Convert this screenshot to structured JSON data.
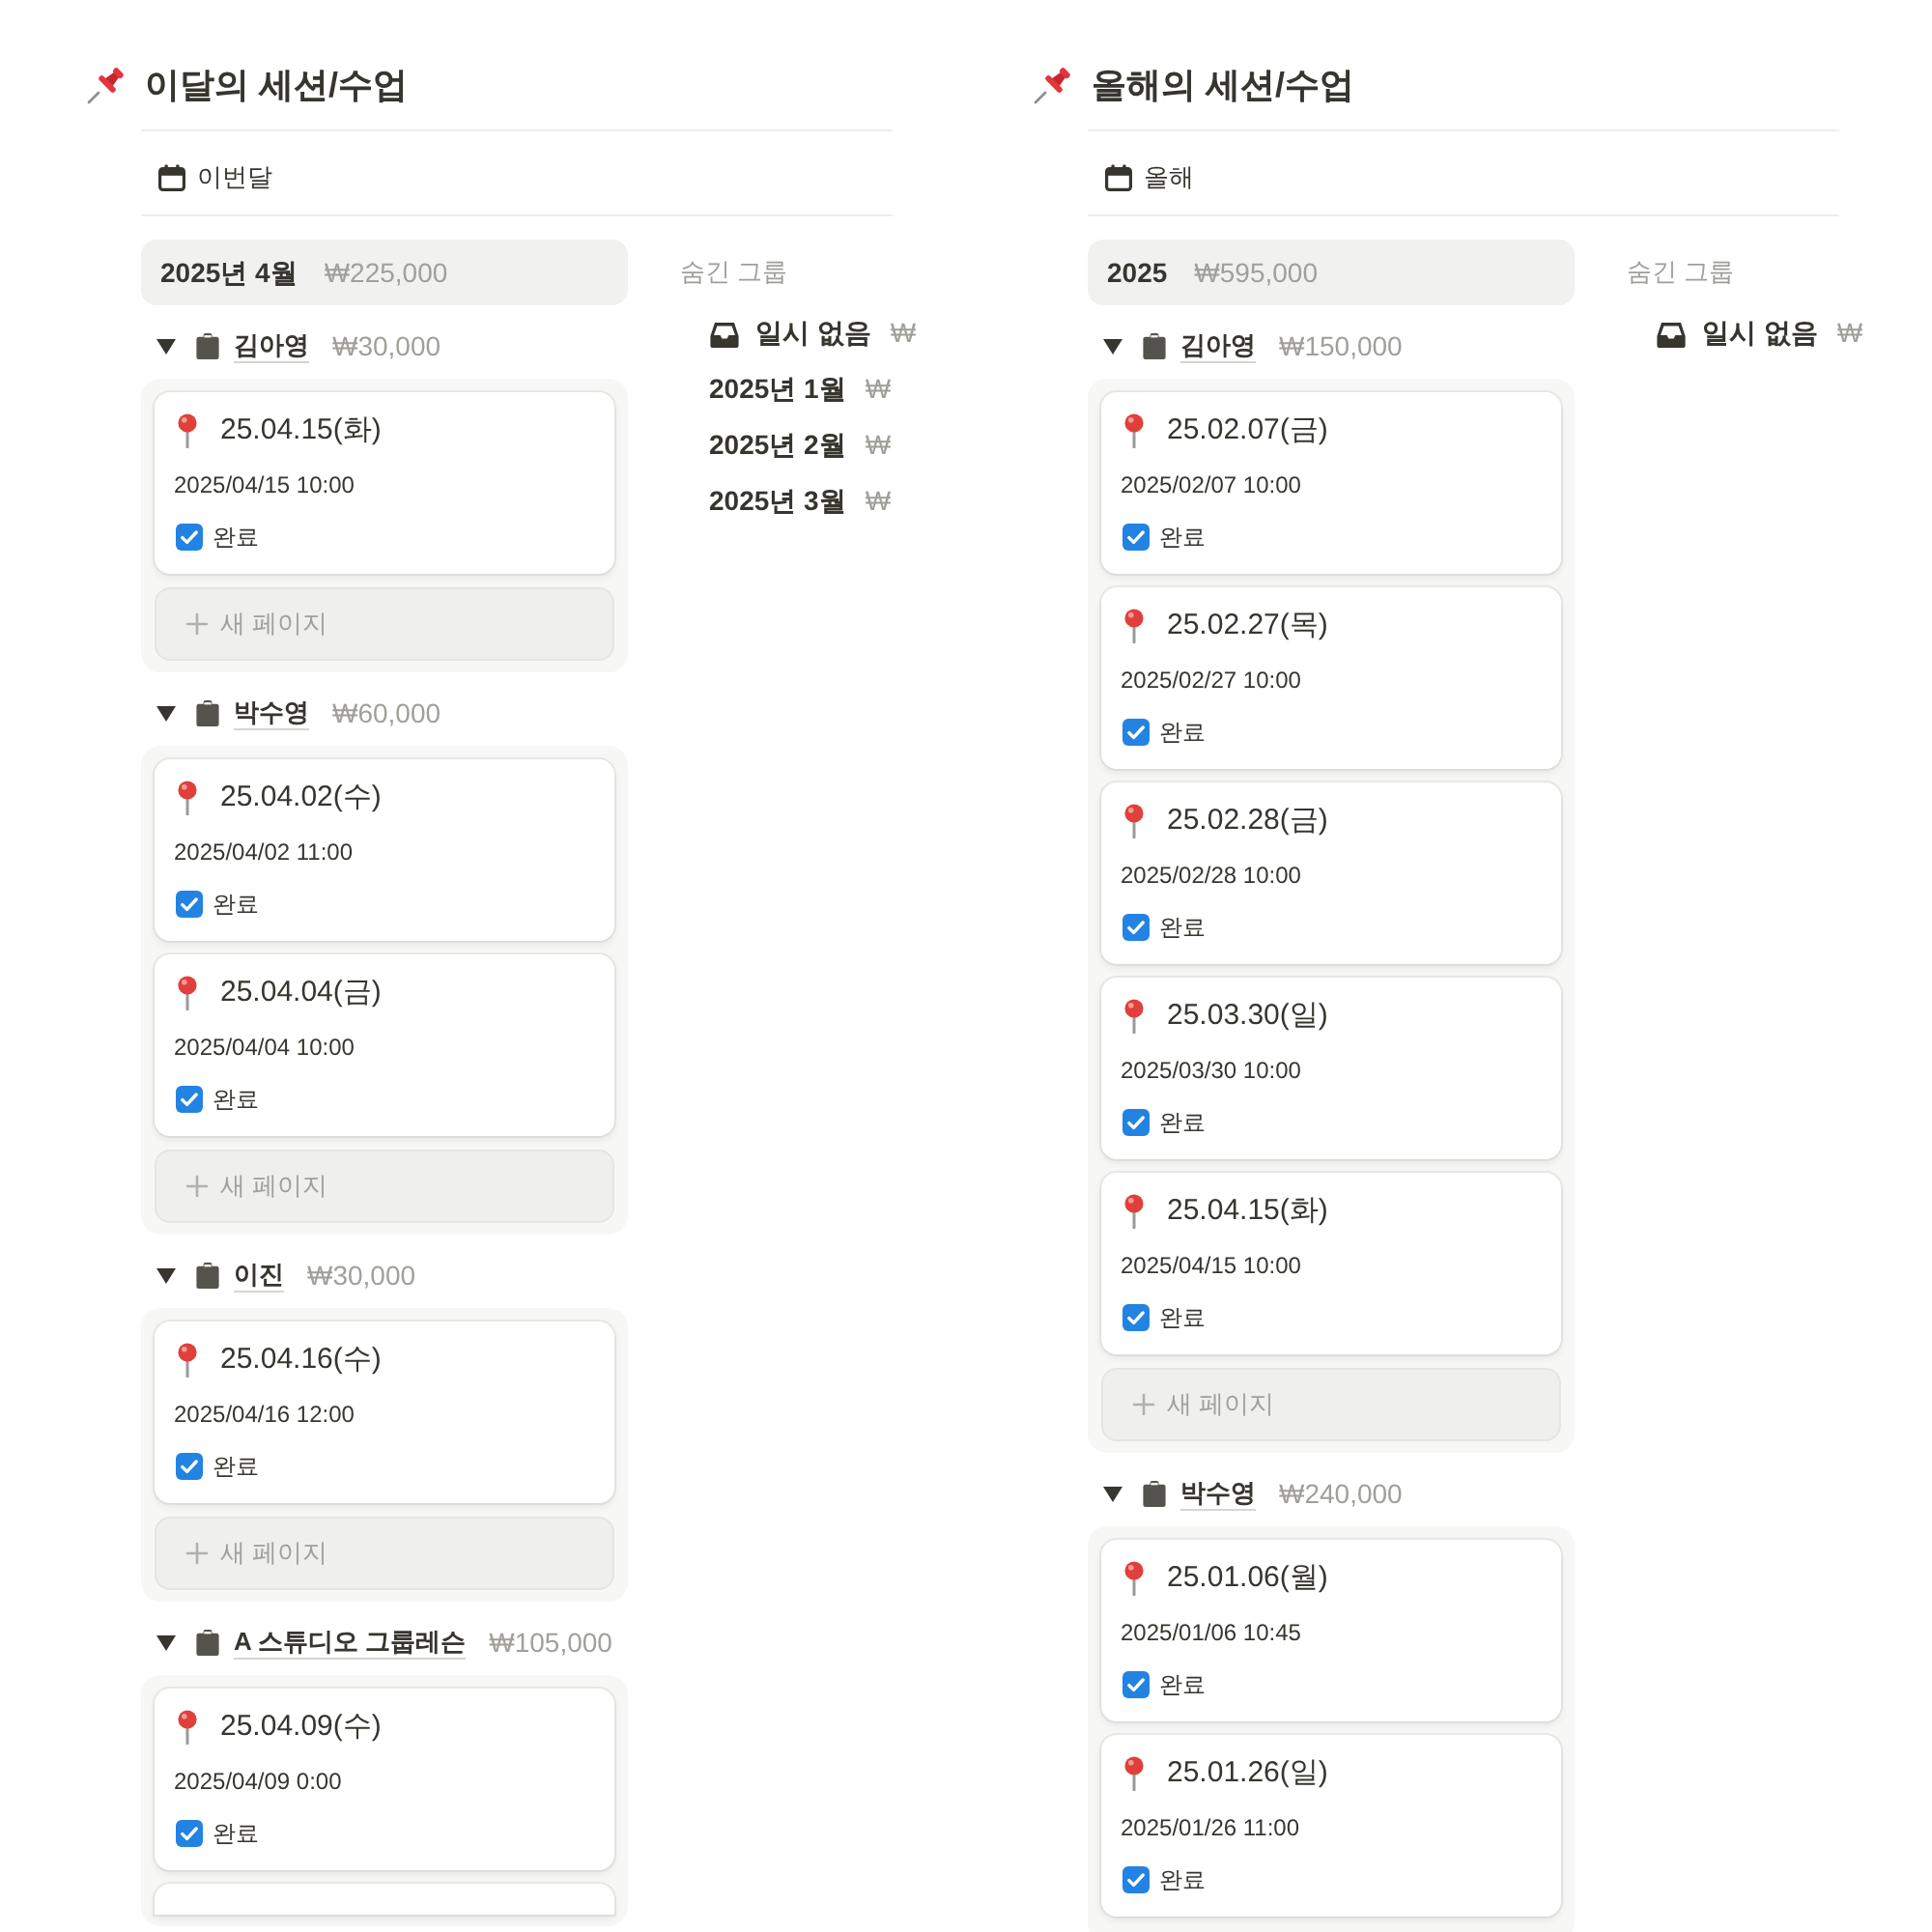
{
  "boards": [
    {
      "title": "이달의 세션/수업",
      "view_tab": "이번달",
      "group": {
        "label": "2025년 4월",
        "total": "₩225,000"
      },
      "subgroups": [
        {
          "name": "김아영",
          "total": "₩30,000",
          "expanded": true,
          "cards": [
            {
              "title": "25.04.15(화)",
              "datetime": "2025/04/15 10:00",
              "status": "완료",
              "checked": true
            }
          ],
          "new_page": "새 페이지"
        },
        {
          "name": "박수영",
          "total": "₩60,000",
          "expanded": true,
          "cards": [
            {
              "title": "25.04.02(수)",
              "datetime": "2025/04/02 11:00",
              "status": "완료",
              "checked": true
            },
            {
              "title": "25.04.04(금)",
              "datetime": "2025/04/04 10:00",
              "status": "완료",
              "checked": true
            }
          ],
          "new_page": "새 페이지"
        },
        {
          "name": "이진",
          "total": "₩30,000",
          "expanded": true,
          "cards": [
            {
              "title": "25.04.16(수)",
              "datetime": "2025/04/16 12:00",
              "status": "완료",
              "checked": true
            }
          ],
          "new_page": "새 페이지"
        },
        {
          "name": "A 스튜디오 그룹레슨",
          "total": "₩105,000",
          "expanded": true,
          "cards": [
            {
              "title": "25.04.09(수)",
              "datetime": "2025/04/09 0:00",
              "status": "완료",
              "checked": true
            }
          ],
          "more_below": true
        }
      ],
      "hidden_groups": {
        "heading": "숨긴 그룹",
        "items": [
          {
            "kind": "no_date",
            "label": "일시 없음",
            "amount": "₩"
          },
          {
            "kind": "month",
            "label": "2025년 1월",
            "amount": "₩"
          },
          {
            "kind": "month",
            "label": "2025년 2월",
            "amount": "₩"
          },
          {
            "kind": "month",
            "label": "2025년 3월",
            "amount": "₩"
          }
        ]
      }
    },
    {
      "title": "올해의 세션/수업",
      "view_tab": "올해",
      "group": {
        "label": "2025",
        "total": "₩595,000"
      },
      "subgroups": [
        {
          "name": "김아영",
          "total": "₩150,000",
          "expanded": true,
          "cards": [
            {
              "title": "25.02.07(금)",
              "datetime": "2025/02/07 10:00",
              "status": "완료",
              "checked": true
            },
            {
              "title": "25.02.27(목)",
              "datetime": "2025/02/27 10:00",
              "status": "완료",
              "checked": true
            },
            {
              "title": "25.02.28(금)",
              "datetime": "2025/02/28 10:00",
              "status": "완료",
              "checked": true
            },
            {
              "title": "25.03.30(일)",
              "datetime": "2025/03/30 10:00",
              "status": "완료",
              "checked": true
            },
            {
              "title": "25.04.15(화)",
              "datetime": "2025/04/15 10:00",
              "status": "완료",
              "checked": true
            }
          ],
          "new_page": "새 페이지"
        },
        {
          "name": "박수영",
          "total": "₩240,000",
          "expanded": true,
          "cards": [
            {
              "title": "25.01.06(월)",
              "datetime": "2025/01/06 10:45",
              "status": "완료",
              "checked": true
            },
            {
              "title": "25.01.26(일)",
              "datetime": "2025/01/26 11:00",
              "status": "완료",
              "checked": true
            }
          ]
        }
      ],
      "hidden_groups": {
        "heading": "숨긴 그룹",
        "items": [
          {
            "kind": "no_date",
            "label": "일시 없음",
            "amount": "₩"
          }
        ]
      }
    }
  ]
}
